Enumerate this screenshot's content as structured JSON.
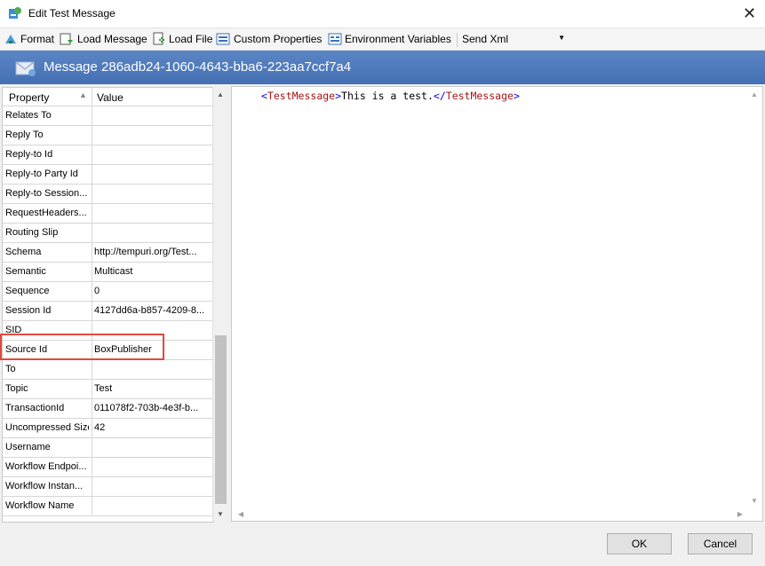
{
  "window": {
    "title": "Edit Test Message",
    "close_glyph": "✕",
    "icon": "message-edit-icon"
  },
  "toolbar": {
    "format": "Format",
    "load_message": "Load Message",
    "load_file": "Load File",
    "custom_properties": "Custom Properties",
    "environment_variables": "Environment Variables",
    "send_mode": "Send Xml"
  },
  "banner": {
    "text": "Message 286adb24-1060-4643-bba6-223aa7ccf7a4",
    "icon": "envelope-icon"
  },
  "grid": {
    "col_property": "Property",
    "col_value": "Value",
    "rows": [
      {
        "p": "Relates To",
        "v": ""
      },
      {
        "p": "Reply To",
        "v": ""
      },
      {
        "p": "Reply-to Id",
        "v": ""
      },
      {
        "p": "Reply-to Party Id",
        "v": ""
      },
      {
        "p": "Reply-to Session...",
        "v": ""
      },
      {
        "p": "RequestHeaders...",
        "v": ""
      },
      {
        "p": "Routing Slip",
        "v": ""
      },
      {
        "p": "Schema",
        "v": "http://tempuri.org/Test..."
      },
      {
        "p": "Semantic",
        "v": "Multicast"
      },
      {
        "p": "Sequence",
        "v": "0"
      },
      {
        "p": "Session Id",
        "v": "4127dd6a-b857-4209-8..."
      },
      {
        "p": "SID",
        "v": ""
      },
      {
        "p": "Source Id",
        "v": "BoxPublisher"
      },
      {
        "p": "To",
        "v": ""
      },
      {
        "p": "Topic",
        "v": "Test"
      },
      {
        "p": "TransactionId",
        "v": "011078f2-703b-4e3f-b..."
      },
      {
        "p": "Uncompressed Size",
        "v": "42"
      },
      {
        "p": "Username",
        "v": ""
      },
      {
        "p": "Workflow Endpoi...",
        "v": ""
      },
      {
        "p": "Workflow Instan...",
        "v": ""
      },
      {
        "p": "Workflow Name",
        "v": ""
      }
    ]
  },
  "editor": {
    "open_bracket": "<",
    "open_tag": "TestMessage",
    "close_bracket": ">",
    "content": "This is a test.",
    "close_open_bracket": "</",
    "close_tag": "TestMessage",
    "close_end": ">"
  },
  "buttons": {
    "ok": "OK",
    "cancel": "Cancel"
  },
  "colors": {
    "banner": "#4a76b8",
    "highlight": "#e04a3f",
    "xml_tag": "#a31515",
    "xml_bracket": "#0000ff"
  }
}
